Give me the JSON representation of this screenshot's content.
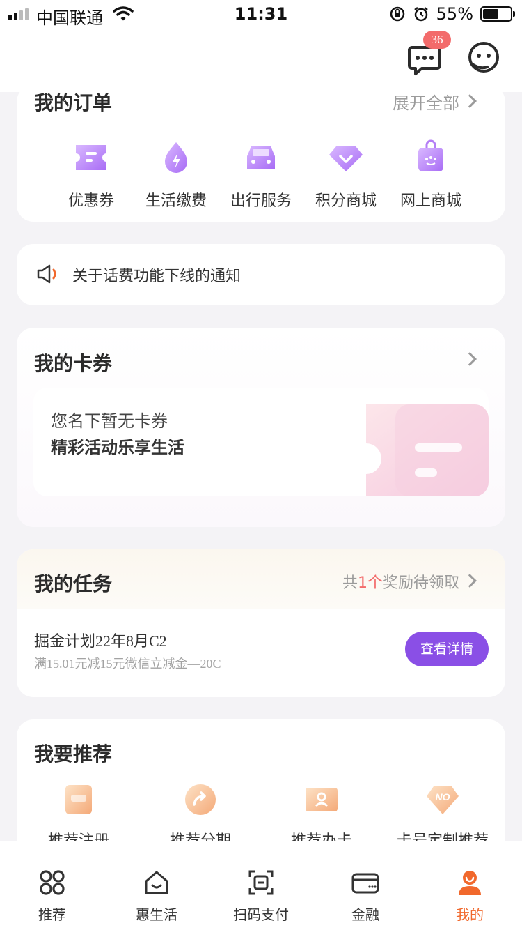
{
  "status_bar": {
    "carrier": "中国联通",
    "time": "11:31",
    "battery": "55%"
  },
  "header": {
    "message_badge": "36"
  },
  "orders": {
    "title": "我的订单",
    "expand": "展开全部",
    "items": [
      {
        "label": "优惠券",
        "icon": "coupon-icon"
      },
      {
        "label": "生活缴费",
        "icon": "bill-payment-icon"
      },
      {
        "label": "出行服务",
        "icon": "car-icon"
      },
      {
        "label": "积分商城",
        "icon": "diamond-icon"
      },
      {
        "label": "网上商城",
        "icon": "shopping-bag-icon"
      }
    ]
  },
  "notice": {
    "text": "关于话费功能下线的通知"
  },
  "my_cards": {
    "title": "我的卡券",
    "empty_line1": "您名下暂无卡券",
    "empty_line2": "精彩活动乐享生活"
  },
  "tasks": {
    "title": "我的任务",
    "reward_prefix": "共",
    "reward_count": "1个",
    "reward_suffix": "奖励待领取",
    "task_name": "掘金计划22年8月C2",
    "task_desc": "满15.01元减15元微信立减金—20C",
    "detail_button": "查看详情"
  },
  "recommend": {
    "title": "我要推荐",
    "items": [
      {
        "label": "推荐注册",
        "icon": "register-icon"
      },
      {
        "label": "推荐分期",
        "icon": "installment-icon"
      },
      {
        "label": "推荐办卡",
        "icon": "apply-card-icon"
      },
      {
        "label": "卡号定制推荐",
        "icon": "custom-number-icon"
      }
    ]
  },
  "tabbar": {
    "items": [
      {
        "label": "推荐",
        "icon": "grid-icon"
      },
      {
        "label": "惠生活",
        "icon": "house-icon"
      },
      {
        "label": "扫码支付",
        "icon": "scan-icon"
      },
      {
        "label": "金融",
        "icon": "wallet-icon"
      },
      {
        "label": "我的",
        "icon": "profile-icon"
      }
    ],
    "active_index": 4
  },
  "colors": {
    "accent": "#8a4fe6",
    "tab_active": "#f1682c",
    "badge": "#f36b6b"
  }
}
